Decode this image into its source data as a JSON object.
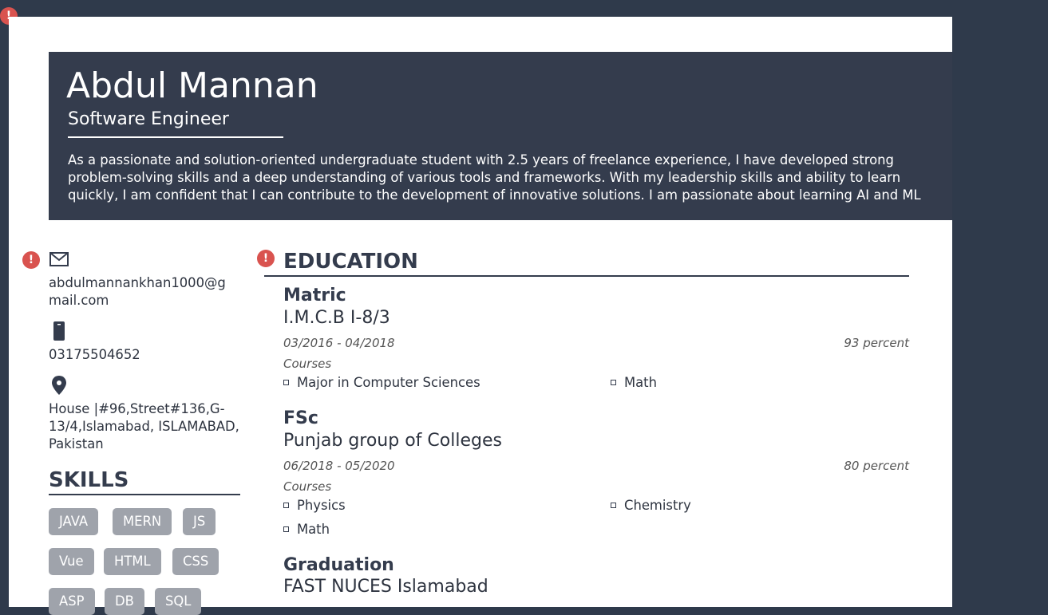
{
  "header": {
    "name": "Abdul Mannan",
    "title": "Software Engineer",
    "summary": "As a passionate and solution-oriented undergraduate student with 2.5 years of freelance experience, I have developed strong problem-solving skills and a deep understanding of various tools and frameworks. With my leadership skills and ability to learn quickly, I am confident that I can contribute to the development of innovative solutions. I am passionate about learning AI and ML"
  },
  "contact": {
    "email_icon": "envelope-icon",
    "email": "abdulmannankhan1000@gmail.com",
    "phone_icon": "mobile-phone-icon",
    "phone": "03175504652",
    "address_icon": "location-pin-icon",
    "address": "House |#96,Street#136,G-13/4,Islamabad, ISLAMABAD, Pakistan"
  },
  "skills": {
    "heading": "SKILLS",
    "items": [
      "JAVA",
      "MERN",
      "JS",
      "Vue",
      "HTML",
      "CSS",
      "ASP",
      "DB",
      "SQL"
    ]
  },
  "education": {
    "heading": "EDUCATION",
    "courses_label": "Courses",
    "entries": [
      {
        "degree": "Matric",
        "institution": "I.M.C.B I-8/3",
        "dates": "03/2016 - 04/2018",
        "grade": "93 percent",
        "courses": [
          "Major in Computer Sciences",
          "Math"
        ]
      },
      {
        "degree": "FSc",
        "institution": "Punjab group of Colleges",
        "dates": "06/2018 - 05/2020",
        "grade": "80 percent",
        "courses": [
          "Physics",
          "Chemistry",
          "Math"
        ]
      },
      {
        "degree": "Graduation",
        "institution": "FAST NUCES Islamabad"
      }
    ]
  },
  "colors": {
    "page_bg": "#2f3a4b",
    "header_bg": "#343c4d",
    "skill_chip": "#9fa3ab",
    "warning": "#d9534f"
  },
  "warning_icon": "!"
}
